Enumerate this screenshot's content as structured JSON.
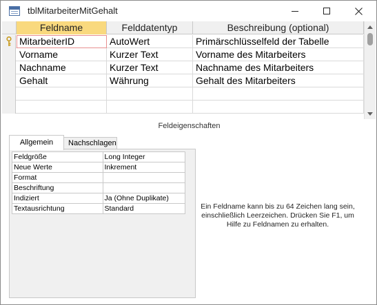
{
  "window": {
    "title": "tblMitarbeiterMitGehalt"
  },
  "grid": {
    "headers": [
      "Feldname",
      "Felddatentyp",
      "Beschreibung (optional)"
    ],
    "rows": [
      {
        "name": "MitarbeiterID",
        "type": "AutoWert",
        "desc": "Primärschlüsselfeld der Tabelle",
        "primary_key": true
      },
      {
        "name": "Vorname",
        "type": "Kurzer Text",
        "desc": "Vorname des Mitarbeiters"
      },
      {
        "name": "Nachname",
        "type": "Kurzer Text",
        "desc": "Nachname des Mitarbeiters"
      },
      {
        "name": "Gehalt",
        "type": "Währung",
        "desc": "Gehalt des Mitarbeiters"
      },
      {
        "name": "",
        "type": "",
        "desc": ""
      },
      {
        "name": "",
        "type": "",
        "desc": ""
      }
    ]
  },
  "properties": {
    "caption": "Feldeigenschaften",
    "tabs": [
      "Allgemein",
      "Nachschlagen"
    ],
    "active_tab": "Allgemein",
    "items": [
      {
        "name": "Feldgröße",
        "value": "Long Integer"
      },
      {
        "name": "Neue Werte",
        "value": "Inkrement"
      },
      {
        "name": "Format",
        "value": ""
      },
      {
        "name": "Beschriftung",
        "value": ""
      },
      {
        "name": "Indiziert",
        "value": "Ja (Ohne Duplikate)"
      },
      {
        "name": "Textausrichtung",
        "value": "Standard"
      }
    ],
    "help_text": "Ein Feldname kann bis zu 64 Zeichen lang sein, einschließlich Leerzeichen. Drücken Sie F1, um Hilfe zu Feldnamen zu erhalten."
  },
  "colors": {
    "selected_header": "#f9d97e",
    "active_cell_border": "#e88e8e",
    "key_icon": "#c89a1c"
  },
  "icons": {
    "title": "table-icon",
    "primary_key": "key-icon"
  }
}
